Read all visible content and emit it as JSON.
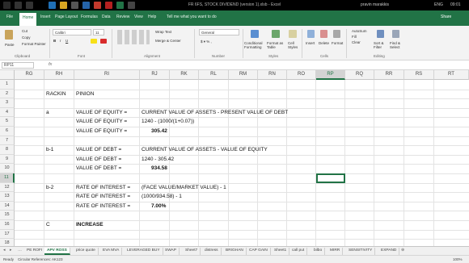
{
  "window": {
    "title": "FR 6FS, STOCK DIVIDEND (version 1).xlsb - Excel",
    "user": "pravin marakkis",
    "clock": "09:01",
    "lang": "ENG"
  },
  "ribbon_tabs": [
    "File",
    "Home",
    "Insert",
    "Page Layout",
    "Formulas",
    "Data",
    "Review",
    "View",
    "Help"
  ],
  "active_tab": "Home",
  "tell_me": "Tell me what you want to do",
  "share_label": "Share",
  "ribbon": {
    "clipboard": {
      "paste": "Paste",
      "cut": "Cut",
      "copy": "Copy",
      "format_painter": "Format Painter",
      "group": "Clipboard"
    },
    "font": {
      "name": "Calibri",
      "size": "11",
      "group": "Font"
    },
    "alignment": {
      "wrap": "Wrap Text",
      "merge": "Merge & Center",
      "group": "Alignment"
    },
    "number": {
      "format": "General",
      "group": "Number"
    },
    "styles": {
      "conditional": "Conditional Formatting",
      "format_as": "Format as Table",
      "cell_styles": "Cell Styles",
      "group": "Styles"
    },
    "cells": {
      "insert": "Insert",
      "delete": "Delete",
      "format": "Format",
      "group": "Cells"
    },
    "editing": {
      "autosum": "AutoSum",
      "fill": "Fill",
      "clear": "Clear",
      "sort": "Sort & Filter",
      "find": "Find & Select",
      "group": "Editing"
    }
  },
  "formula_bar": {
    "name_box": "RP11",
    "fx": "fx",
    "content": ""
  },
  "columns": [
    "RG",
    "RH",
    "RI",
    "RJ",
    "RK",
    "RL",
    "RM",
    "RN",
    "RO",
    "RP",
    "RQ",
    "RR",
    "RS",
    "RT"
  ],
  "selected_column": "RP",
  "rows": [
    "1",
    "2",
    "3",
    "4",
    "5",
    "6",
    "7",
    "8",
    "9",
    "10",
    "11",
    "12",
    "13",
    "14",
    "15",
    "16",
    "17",
    "18",
    "19"
  ],
  "selected_row": "11",
  "cells": [
    {
      "row": 2,
      "col": "RH",
      "text": "RACKIN",
      "bold": false
    },
    {
      "row": 2,
      "col": "RI",
      "text": "PINION",
      "bold": false
    },
    {
      "row": 4,
      "col": "RH",
      "text": "a",
      "bold": false
    },
    {
      "row": 4,
      "col": "RI",
      "text": "VALUE OF EQUITY =",
      "bold": false
    },
    {
      "row": 4,
      "col": "RJ",
      "text": "CURRENT VALUE OF ASSETS - PRESENT VALUE OF DEBT",
      "bold": false
    },
    {
      "row": 5,
      "col": "RI",
      "text": "VALUE OF EQUITY =",
      "bold": false
    },
    {
      "row": 5,
      "col": "RJ",
      "text": "1240 - (1000/(1+0.07))",
      "bold": false
    },
    {
      "row": 6,
      "col": "RI",
      "text": "VALUE OF EQUITY =",
      "bold": false
    },
    {
      "row": 6,
      "col": "RJ",
      "text": "305.42",
      "bold": true,
      "indent": true
    },
    {
      "row": 8,
      "col": "RH",
      "text": "b-1",
      "bold": false
    },
    {
      "row": 8,
      "col": "RI",
      "text": "VALUE OF DEBT =",
      "bold": false
    },
    {
      "row": 8,
      "col": "RJ",
      "text": "CURRENT VALUE OF ASSETS - VALUE OF EQUITY",
      "bold": false
    },
    {
      "row": 9,
      "col": "RI",
      "text": "VALUE OF DEBT =",
      "bold": false
    },
    {
      "row": 9,
      "col": "RJ",
      "text": "1240 - 305.42",
      "bold": false
    },
    {
      "row": 10,
      "col": "RI",
      "text": "VALUE OF DEBT =",
      "bold": false
    },
    {
      "row": 10,
      "col": "RJ",
      "text": "934.58",
      "bold": true,
      "indent": true
    },
    {
      "row": 12,
      "col": "RH",
      "text": "b-2",
      "bold": false
    },
    {
      "row": 12,
      "col": "RI",
      "text": "RATE OF INTEREST =",
      "bold": false
    },
    {
      "row": 12,
      "col": "RJ",
      "text": "(FACE VALUE/MARKET VALUE) - 1",
      "bold": false
    },
    {
      "row": 13,
      "col": "RI",
      "text": "RATE OF INTEREST =",
      "bold": false
    },
    {
      "row": 13,
      "col": "RJ",
      "text": "(1000/934.58) - 1",
      "bold": false
    },
    {
      "row": 14,
      "col": "RI",
      "text": "RATE OF INTEREST =",
      "bold": false
    },
    {
      "row": 14,
      "col": "RJ",
      "text": "7.00%",
      "bold": true,
      "indent": true
    },
    {
      "row": 16,
      "col": "RH",
      "text": "C",
      "bold": false
    },
    {
      "row": 16,
      "col": "RI",
      "text": "INCREASE",
      "bold": true
    }
  ],
  "sheet_tabs": [
    "PE ROFI",
    "APV ROSS",
    "price quote",
    "EVA MVA",
    "LEVERAGED BUY",
    "SWAP",
    "Sheet7",
    "distress",
    "BRIGHAN",
    "CAP GAIN",
    "Sheet1",
    "call put",
    "bilbo",
    "MIRR",
    "SENSITIVITY",
    "EXPAND"
  ],
  "active_sheet": "APV ROSS",
  "status": {
    "ready": "Ready",
    "circular": "Circular References: AK123",
    "zoom": "100%"
  },
  "colors": {
    "excel_green": "#217346",
    "titlebar": "#000000",
    "ribbon_bg": "#f3f3f3"
  }
}
